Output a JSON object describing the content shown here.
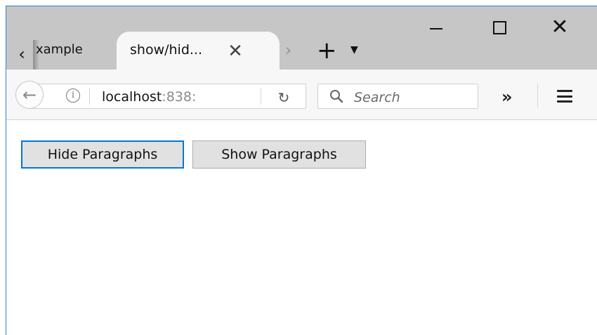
{
  "tabs": [
    {
      "title": "xample",
      "active": false
    },
    {
      "title": "show/hid...",
      "active": true
    }
  ],
  "address_bar": {
    "host": "localhost",
    "port": ":838:"
  },
  "search": {
    "placeholder": "Search"
  },
  "toolbar_icons": [
    "back-arrow-icon",
    "info-icon",
    "reload-icon",
    "search-icon",
    "overflow-chevron-icon",
    "hamburger-menu-icon"
  ],
  "window_controls": [
    "minimize",
    "maximize",
    "close"
  ],
  "page": {
    "buttons": [
      {
        "label": "Hide Paragraphs",
        "focused": true
      },
      {
        "label": "Show Paragraphs",
        "focused": false
      }
    ]
  },
  "colors": {
    "focus_ring": "#0078d7",
    "tab_strip": "#c6c6c6",
    "toolbar": "#f7f7f7",
    "button_face": "#e1e1e1"
  }
}
